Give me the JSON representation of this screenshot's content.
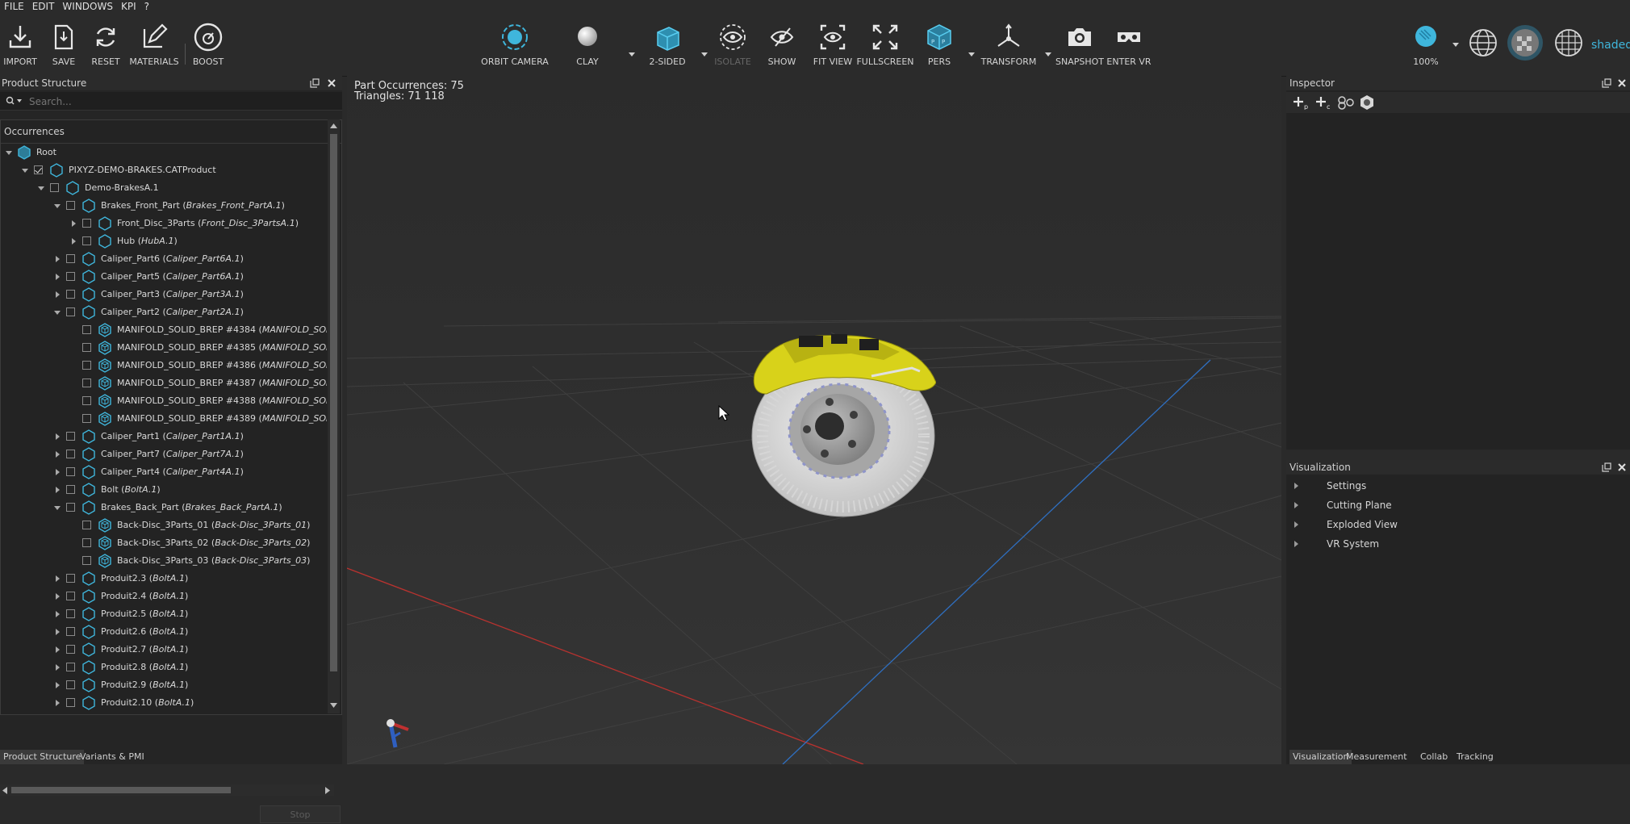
{
  "menu": [
    "FILE",
    "EDIT",
    "WINDOWS",
    "KPI",
    "?"
  ],
  "toolbar": {
    "import": "IMPORT",
    "save": "SAVE",
    "reset": "RESET",
    "materials": "MATERIALS",
    "boost": "BOOST",
    "orbit_camera": "ORBIT CAMERA",
    "clay": "CLAY",
    "two_sided": "2-SIDED",
    "isolate": "ISOLATE",
    "show": "SHOW",
    "fit_view": "FIT VIEW",
    "fullscreen": "FULLSCREEN",
    "pers": "PERS",
    "transform": "TRANSFORM",
    "snapshot": "SNAPSHOT",
    "enter_vr": "ENTER VR",
    "zoom": "100%",
    "render_mode": "shaded"
  },
  "product_structure": {
    "title": "Product Structure",
    "search_placeholder": "Search...",
    "header": "Occurrences",
    "rows": [
      {
        "name": "Root",
        "ref": ""
      },
      {
        "name": "PIXYZ-DEMO-BRAKES.CATProduct",
        "ref": ""
      },
      {
        "name": "Demo-BrakesA.1",
        "ref": ""
      },
      {
        "name": "Brakes_Front_Part",
        "ref": "Brakes_Front_PartA.1"
      },
      {
        "name": "Front_Disc_3Parts",
        "ref": "Front_Disc_3PartsA.1"
      },
      {
        "name": "Hub",
        "ref": "HubA.1"
      },
      {
        "name": "Caliper_Part6",
        "ref": "Caliper_Part6A.1"
      },
      {
        "name": "Caliper_Part5",
        "ref": "Caliper_Part6A.1"
      },
      {
        "name": "Caliper_Part3",
        "ref": "Caliper_Part3A.1"
      },
      {
        "name": "Caliper_Part2",
        "ref": "Caliper_Part2A.1"
      },
      {
        "name": "MANIFOLD_SOLID_BREP #4384",
        "ref": "MANIFOLD_SOLID"
      },
      {
        "name": "MANIFOLD_SOLID_BREP #4385",
        "ref": "MANIFOLD_SOLID"
      },
      {
        "name": "MANIFOLD_SOLID_BREP #4386",
        "ref": "MANIFOLD_SOLID"
      },
      {
        "name": "MANIFOLD_SOLID_BREP #4387",
        "ref": "MANIFOLD_SOLID"
      },
      {
        "name": "MANIFOLD_SOLID_BREP #4388",
        "ref": "MANIFOLD_SOLID"
      },
      {
        "name": "MANIFOLD_SOLID_BREP #4389",
        "ref": "MANIFOLD_SOLID"
      },
      {
        "name": "Caliper_Part1",
        "ref": "Caliper_Part1A.1"
      },
      {
        "name": "Caliper_Part7",
        "ref": "Caliper_Part7A.1"
      },
      {
        "name": "Caliper_Part4",
        "ref": "Caliper_Part4A.1"
      },
      {
        "name": "Bolt",
        "ref": "BoltA.1"
      },
      {
        "name": "Brakes_Back_Part",
        "ref": "Brakes_Back_PartA.1"
      },
      {
        "name": "Back-Disc_3Parts_01",
        "ref": "Back-Disc_3Parts_01"
      },
      {
        "name": "Back-Disc_3Parts_02",
        "ref": "Back-Disc_3Parts_02"
      },
      {
        "name": "Back-Disc_3Parts_03",
        "ref": "Back-Disc_3Parts_03"
      },
      {
        "name": "Produit2.3",
        "ref": "BoltA.1"
      },
      {
        "name": "Produit2.4",
        "ref": "BoltA.1"
      },
      {
        "name": "Produit2.5",
        "ref": "BoltA.1"
      },
      {
        "name": "Produit2.6",
        "ref": "BoltA.1"
      },
      {
        "name": "Produit2.7",
        "ref": "BoltA.1"
      },
      {
        "name": "Produit2.8",
        "ref": "BoltA.1"
      },
      {
        "name": "Produit2.9",
        "ref": "BoltA.1"
      },
      {
        "name": "Produit2.10",
        "ref": "BoltA.1"
      }
    ],
    "stop_button": "Stop",
    "tabs": [
      "Product Structure",
      "Variants & PMI"
    ]
  },
  "viewport": {
    "part_occurrences": "Part Occurrences: 75",
    "triangles": "Triangles: 71 118"
  },
  "inspector": {
    "title": "Inspector"
  },
  "visualization": {
    "title": "Visualization",
    "items": [
      "Settings",
      "Cutting Plane",
      "Exploded View",
      "VR System"
    ],
    "tabs": [
      "Visualization",
      "Measurement",
      "Collab",
      "Tracking"
    ]
  },
  "colors": {
    "accent": "#3fb6dc",
    "caliper": "#d8d21a",
    "x_axis": "#b8322f",
    "z_axis": "#2f6fc0"
  }
}
